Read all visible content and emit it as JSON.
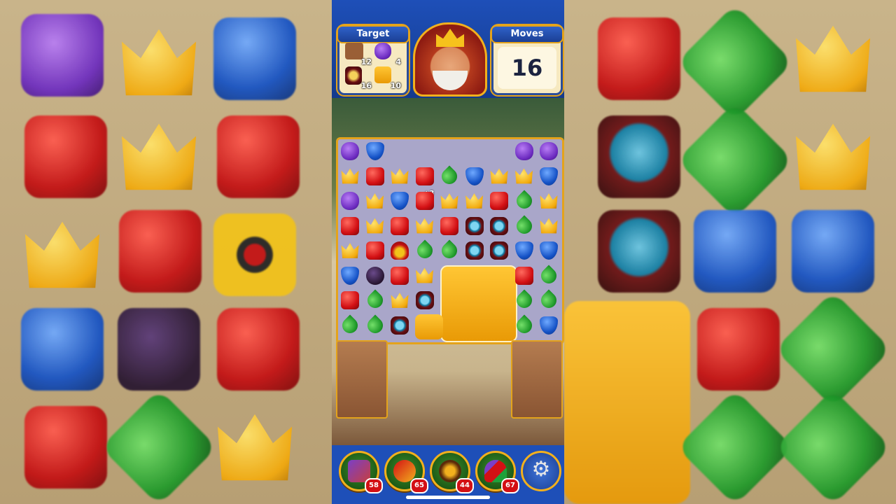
{
  "header": {
    "target_title": "Target",
    "moves_title": "Moves",
    "moves_value": "16",
    "targets": [
      {
        "icon": "dirt-block-icon",
        "count": "12"
      },
      {
        "icon": "purple-frog-icon",
        "count": "4"
      },
      {
        "icon": "lantern-icon",
        "count": "16"
      },
      {
        "icon": "orange-block-icon",
        "count": "10"
      }
    ]
  },
  "board": {
    "bonus_popup": "+3",
    "grid": [
      [
        "purple",
        "shield",
        "",
        "",
        "",
        "",
        "",
        "purple",
        "purple"
      ],
      [
        "crown",
        "red",
        "crown",
        "red",
        "leaf",
        "shield",
        "crown",
        "crown",
        "shield"
      ],
      [
        "purple",
        "crown",
        "shield",
        "red",
        "crown",
        "crown",
        "red",
        "leaf",
        "crown"
      ],
      [
        "red",
        "crown",
        "red",
        "crown",
        "red",
        "lantern",
        "lantern",
        "leaf",
        "crown"
      ],
      [
        "crown",
        "red",
        "jester",
        "leaf",
        "leaf",
        "lantern",
        "lantern",
        "shield",
        "shield"
      ],
      [
        "shield",
        "bomb",
        "red",
        "crown",
        "",
        "",
        "",
        "red",
        "leaf"
      ],
      [
        "red",
        "leaf",
        "crown",
        "lantern",
        "",
        "",
        "",
        "leaf",
        "leaf"
      ],
      [
        "leaf",
        "leaf",
        "lantern",
        "",
        "",
        "",
        "",
        "leaf",
        "shield"
      ]
    ]
  },
  "boosters": [
    {
      "name": "hammer-booster",
      "count": "58"
    },
    {
      "name": "arrow-booster",
      "count": "65"
    },
    {
      "name": "cannon-booster",
      "count": "44"
    },
    {
      "name": "jester-hat-booster",
      "count": "67"
    }
  ],
  "colors": {
    "frame_gold": "#e4a31b",
    "header_blue": "#1e4fb8",
    "booster_count_red": "#d31014"
  }
}
